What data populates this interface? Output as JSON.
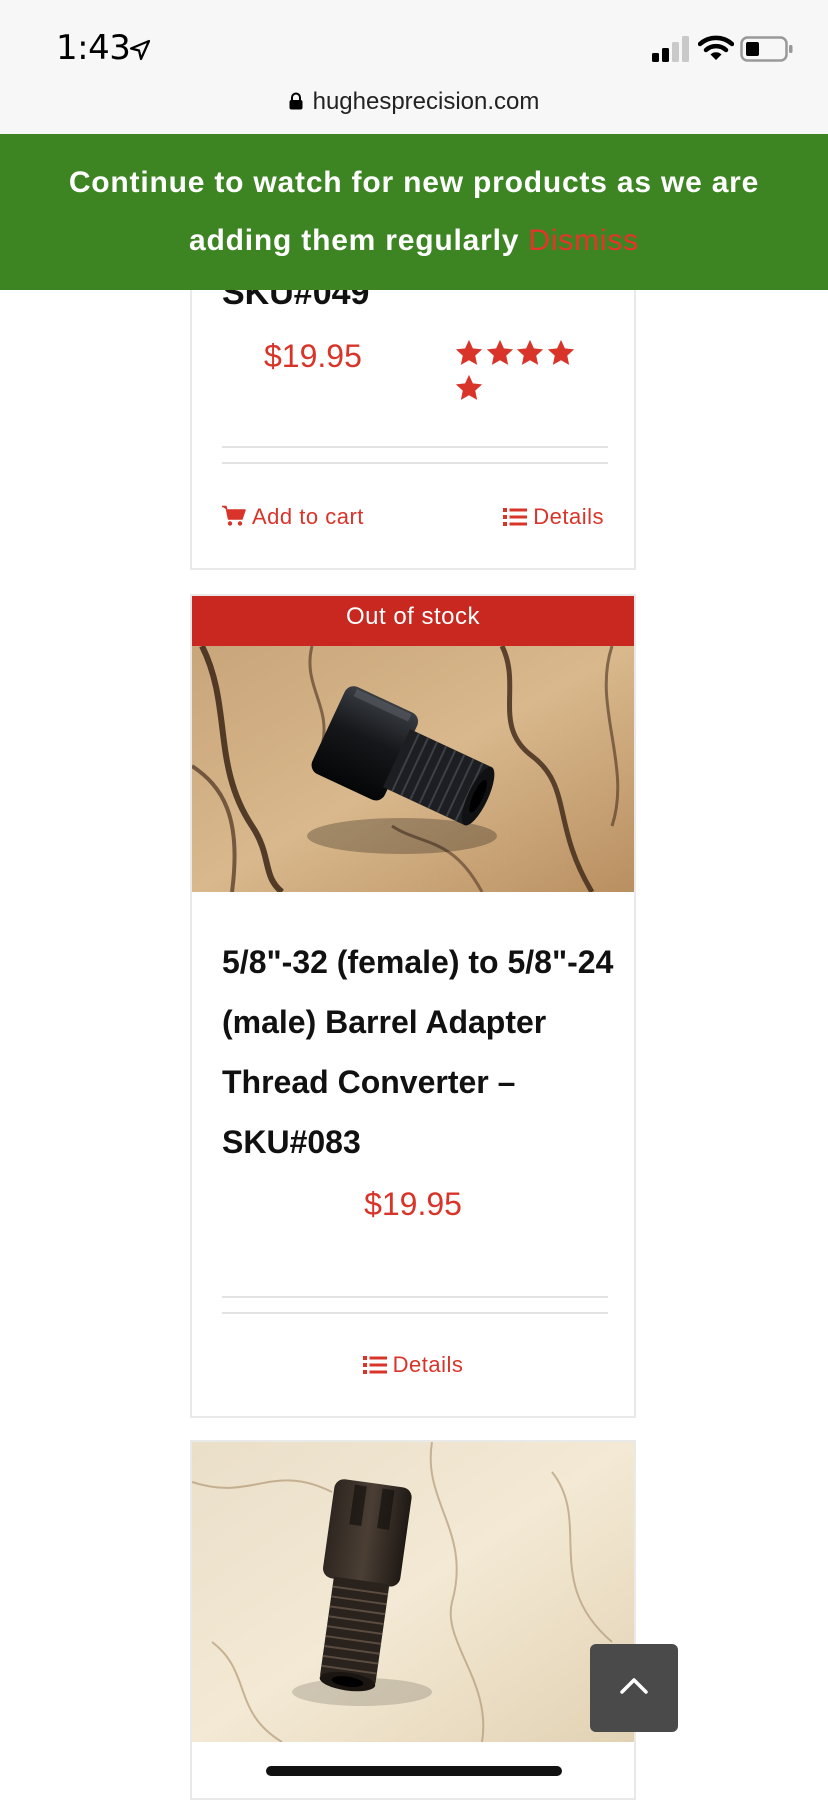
{
  "status_bar": {
    "time": "1:43",
    "url": "hughesprecision.com"
  },
  "banner": {
    "message": "Continue to watch for new products as we are adding them regularly",
    "dismiss_label": "Dismiss"
  },
  "product1": {
    "sku_tail": "SKU#049",
    "price": "$19.95",
    "rating": 5,
    "add_to_cart_label": "Add to cart",
    "details_label": "Details"
  },
  "product2": {
    "badge": "Out of stock",
    "title": "5/8\"-32 (female) to 5/8\"-24 (male) Barrel Adapter Thread Converter – SKU#083",
    "price": "$19.95",
    "details_label": "Details"
  },
  "colors": {
    "accent": "#d9342a",
    "banner_bg": "#3d8423",
    "badge_bg": "#c8281f",
    "back_to_top_bg": "#4a4a4a"
  },
  "icons": [
    "location-arrow-icon",
    "signal-icon",
    "wifi-icon",
    "battery-icon",
    "lock-icon",
    "star-icon",
    "cart-icon",
    "list-icon",
    "chevron-up-icon"
  ]
}
